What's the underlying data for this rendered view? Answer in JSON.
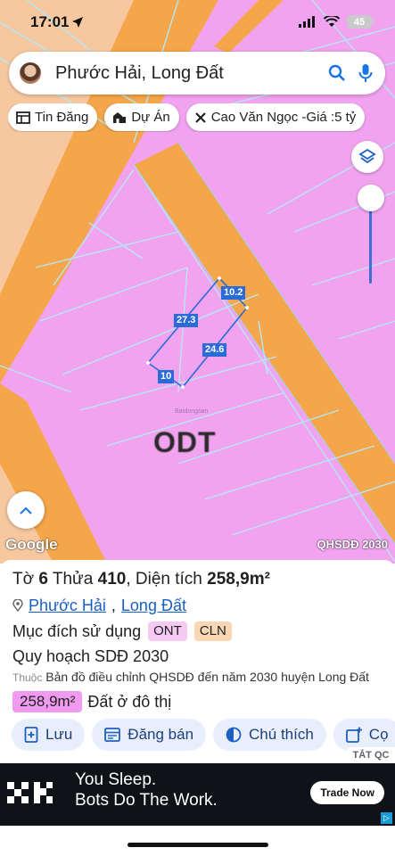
{
  "status_bar": {
    "time": "17:01",
    "battery": "45"
  },
  "search": {
    "query": "Phước Hải, Long Đất"
  },
  "chips": [
    {
      "label": "Tin Đăng",
      "icon": "listing-icon"
    },
    {
      "label": "Dự Án",
      "icon": "building-icon"
    },
    {
      "label": "Cao Văn Ngọc -Giá :5 tỷ",
      "icon": "tools-icon"
    }
  ],
  "map": {
    "zone_code": "ODT",
    "dimensions": [
      "10.2",
      "27.3",
      "24.6",
      "10"
    ],
    "attribution": "Google",
    "source_label": "QHSDĐ 2030",
    "watermark": "Batdongsan",
    "colors": {
      "residential": "#f2a3f0",
      "road": "#f5a54a",
      "farmland": "#f7c8a0",
      "parcel_lines": "#b6e7f5",
      "parcel_outline": "#2b6bd8"
    }
  },
  "panel": {
    "sheet_label": "Tờ",
    "sheet_no": "6",
    "parcel_label": "Thửa",
    "parcel_no": "410",
    "area_label": "Diện tích",
    "area_value": "258,9m²",
    "ward": "Phước Hải",
    "district": "Long Đất",
    "purpose_label": "Mục đích sử dụng",
    "purpose_tags": [
      {
        "code": "ONT",
        "color": "#f6c9f4"
      },
      {
        "code": "CLN",
        "color": "#f9d7b5"
      }
    ],
    "plan_title": "Quy hoạch SDĐ 2030",
    "plan_prefix": "Thuộc",
    "plan_source": "Bản đồ điều chỉnh QHSDĐ đến năm 2030 huyện Long Đất",
    "plan_area": "258,9m²",
    "plan_usage": "Đất ở đô thị",
    "actions": [
      {
        "label": "Lưu",
        "icon": "bookmark-plus-icon"
      },
      {
        "label": "Đăng bán",
        "icon": "sell-icon"
      },
      {
        "label": "Chú thích",
        "icon": "contrast-icon"
      },
      {
        "label": "Cọ",
        "icon": "add-image-icon"
      }
    ]
  },
  "ad": {
    "close_label": "TẮT QC",
    "brand": "OKX",
    "headline_1": "You Sleep.",
    "headline_2": "Bots Do The Work.",
    "cta": "Trade Now"
  }
}
